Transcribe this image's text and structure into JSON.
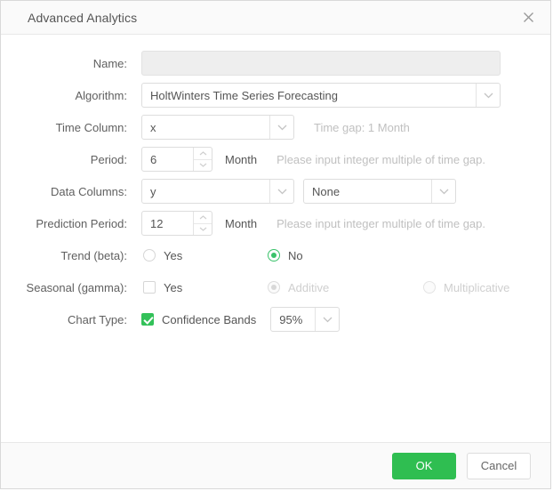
{
  "dialog": {
    "title": "Advanced Analytics",
    "close_icon": "close-icon"
  },
  "form": {
    "name": {
      "label": "Name:",
      "value": "",
      "placeholder": ""
    },
    "algorithm": {
      "label": "Algorithm:",
      "value": "HoltWinters Time Series Forecasting"
    },
    "time_column": {
      "label": "Time Column:",
      "value": "x",
      "time_gap": "Time gap: 1 Month"
    },
    "period": {
      "label": "Period:",
      "value": "6",
      "unit": "Month",
      "hint": "Please input integer multiple of time gap."
    },
    "data_columns": {
      "label": "Data Columns:",
      "primary": "y",
      "secondary": "None"
    },
    "prediction_period": {
      "label": "Prediction Period:",
      "value": "12",
      "unit": "Month",
      "hint": "Please input integer multiple of time gap."
    },
    "trend": {
      "label": "Trend (beta):",
      "yes_label": "Yes",
      "no_label": "No",
      "selected": "No"
    },
    "seasonal": {
      "label": "Seasonal (gamma):",
      "yes_label": "Yes",
      "yes_checked": false,
      "additive_label": "Additive",
      "multiplicative_label": "Multiplicative",
      "selected": "Additive",
      "options_disabled": true
    },
    "chart_type": {
      "label": "Chart Type:",
      "confidence_label": "Confidence Bands",
      "confidence_checked": true,
      "confidence_level": "95%"
    }
  },
  "footer": {
    "ok_label": "OK",
    "cancel_label": "Cancel"
  },
  "colors": {
    "accent_green": "#2fbe51",
    "checkbox_green": "#33c159",
    "radio_green": "#3ac26a",
    "header_bg": "#fafafa",
    "border": "#dddddd",
    "hint_text": "#c0c0c0"
  }
}
